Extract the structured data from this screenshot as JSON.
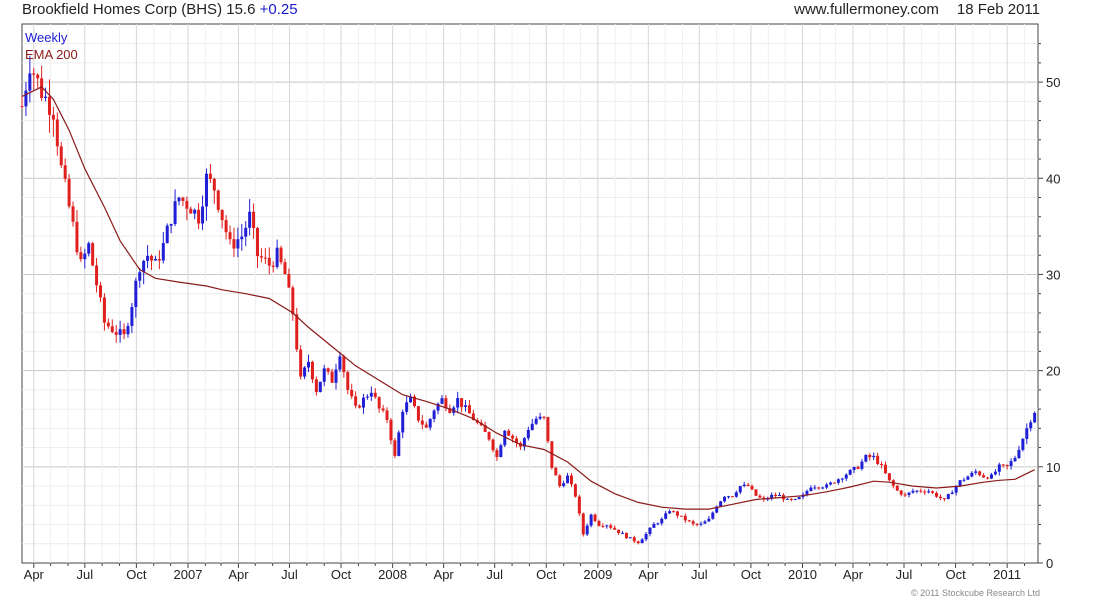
{
  "header": {
    "title": "Brookfield Homes Corp (BHS)",
    "price": "15.6",
    "change": "+0.25",
    "website": "www.fullermoney.com",
    "date": "18 Feb 2011"
  },
  "copyright": "© 2011 Stockcube Research Ltd",
  "colors": {
    "up": "#1f1fd6",
    "down": "#e0201e",
    "ema": "#8b1a1a",
    "grid": "#dedede",
    "axis": "#444444"
  },
  "chart_data": {
    "type": "candlestick",
    "legend": [
      {
        "label": "Weekly",
        "color": "#1f1fd6"
      },
      {
        "label": "EMA 200",
        "color": "#8b1a1a"
      }
    ],
    "legend_position": "top-left",
    "grid": true,
    "y_axis_side": "right",
    "ylim": [
      0,
      55
    ],
    "y_ticks": [
      0,
      10,
      20,
      30,
      40,
      50
    ],
    "xlim": [
      "2006-03-11",
      "2011-02-25"
    ],
    "x_ticks": [
      {
        "label": "Apr",
        "date": "2006-04-01"
      },
      {
        "label": "Jul",
        "date": "2006-07-01"
      },
      {
        "label": "Oct",
        "date": "2006-10-01"
      },
      {
        "label": "2007",
        "date": "2007-01-01"
      },
      {
        "label": "Apr",
        "date": "2007-04-01"
      },
      {
        "label": "Jul",
        "date": "2007-07-01"
      },
      {
        "label": "Oct",
        "date": "2007-10-01"
      },
      {
        "label": "2008",
        "date": "2008-01-01"
      },
      {
        "label": "Apr",
        "date": "2008-04-01"
      },
      {
        "label": "Jul",
        "date": "2008-07-01"
      },
      {
        "label": "Oct",
        "date": "2008-10-01"
      },
      {
        "label": "2009",
        "date": "2009-01-01"
      },
      {
        "label": "Apr",
        "date": "2009-04-01"
      },
      {
        "label": "Jul",
        "date": "2009-07-01"
      },
      {
        "label": "Oct",
        "date": "2009-10-01"
      },
      {
        "label": "2010",
        "date": "2010-01-01"
      },
      {
        "label": "Apr",
        "date": "2010-04-01"
      },
      {
        "label": "Jul",
        "date": "2010-07-01"
      },
      {
        "label": "Oct",
        "date": "2010-10-01"
      },
      {
        "label": "2011",
        "date": "2011-01-01"
      }
    ],
    "close_anchors": [
      [
        "2006-03-11",
        47.5
      ],
      [
        "2006-03-25",
        52
      ],
      [
        "2006-04-15",
        49
      ],
      [
        "2006-05-06",
        47
      ],
      [
        "2006-05-20",
        41
      ],
      [
        "2006-06-10",
        35
      ],
      [
        "2006-06-24",
        31
      ],
      [
        "2006-07-08",
        33
      ],
      [
        "2006-07-22",
        29
      ],
      [
        "2006-08-05",
        25
      ],
      [
        "2006-08-26",
        24
      ],
      [
        "2006-09-09",
        23.5
      ],
      [
        "2006-09-23",
        27
      ],
      [
        "2006-10-07",
        31
      ],
      [
        "2006-10-21",
        32
      ],
      [
        "2006-11-04",
        31
      ],
      [
        "2006-11-18",
        33
      ],
      [
        "2006-12-02",
        36
      ],
      [
        "2006-12-16",
        38
      ],
      [
        "2007-01-06",
        37
      ],
      [
        "2007-01-20",
        36
      ],
      [
        "2007-02-03",
        40
      ],
      [
        "2007-02-17",
        39
      ],
      [
        "2007-03-03",
        36
      ],
      [
        "2007-03-17",
        33
      ],
      [
        "2007-04-07",
        34
      ],
      [
        "2007-04-21",
        36
      ],
      [
        "2007-05-05",
        32
      ],
      [
        "2007-05-26",
        31
      ],
      [
        "2007-06-09",
        32
      ],
      [
        "2007-06-23",
        30
      ],
      [
        "2007-07-07",
        26
      ],
      [
        "2007-07-21",
        19
      ],
      [
        "2007-08-04",
        21
      ],
      [
        "2007-08-18",
        18
      ],
      [
        "2007-09-01",
        20
      ],
      [
        "2007-09-15",
        19
      ],
      [
        "2007-09-29",
        22
      ],
      [
        "2007-10-13",
        18
      ],
      [
        "2007-10-27",
        16
      ],
      [
        "2007-11-10",
        17
      ],
      [
        "2007-11-24",
        18
      ],
      [
        "2007-12-08",
        16
      ],
      [
        "2007-12-22",
        15
      ],
      [
        "2008-01-05",
        11
      ],
      [
        "2008-01-19",
        16
      ],
      [
        "2008-02-02",
        17
      ],
      [
        "2008-02-16",
        15
      ],
      [
        "2008-03-01",
        14
      ],
      [
        "2008-03-15",
        16
      ],
      [
        "2008-03-29",
        17
      ],
      [
        "2008-04-12",
        16
      ],
      [
        "2008-04-26",
        17
      ],
      [
        "2008-05-10",
        16
      ],
      [
        "2008-05-24",
        15
      ],
      [
        "2008-06-07",
        14
      ],
      [
        "2008-06-21",
        13
      ],
      [
        "2008-07-05",
        11
      ],
      [
        "2008-07-19",
        14
      ],
      [
        "2008-08-02",
        13
      ],
      [
        "2008-08-16",
        12
      ],
      [
        "2008-08-30",
        14
      ],
      [
        "2008-09-13",
        15
      ],
      [
        "2008-09-27",
        15
      ],
      [
        "2008-10-11",
        10
      ],
      [
        "2008-10-25",
        8
      ],
      [
        "2008-11-08",
        9
      ],
      [
        "2008-11-22",
        7
      ],
      [
        "2008-12-06",
        3
      ],
      [
        "2008-12-20",
        5
      ],
      [
        "2009-01-03",
        4
      ],
      [
        "2009-01-17",
        4
      ],
      [
        "2009-01-31",
        3.5
      ],
      [
        "2009-02-14",
        3
      ],
      [
        "2009-02-28",
        2.5
      ],
      [
        "2009-03-14",
        2.2
      ],
      [
        "2009-03-28",
        3
      ],
      [
        "2009-04-11",
        4
      ],
      [
        "2009-04-25",
        4.5
      ],
      [
        "2009-05-09",
        5.5
      ],
      [
        "2009-05-23",
        5
      ],
      [
        "2009-06-06",
        4.5
      ],
      [
        "2009-06-20",
        4
      ],
      [
        "2009-07-04",
        4
      ],
      [
        "2009-07-18",
        4.5
      ],
      [
        "2009-08-01",
        6
      ],
      [
        "2009-08-15",
        7
      ],
      [
        "2009-08-29",
        7
      ],
      [
        "2009-09-12",
        8
      ],
      [
        "2009-09-26",
        8
      ],
      [
        "2009-10-10",
        7
      ],
      [
        "2009-10-24",
        6.5
      ],
      [
        "2009-11-07",
        7
      ],
      [
        "2009-11-21",
        7
      ],
      [
        "2009-12-05",
        6.5
      ],
      [
        "2009-12-19",
        6.5
      ],
      [
        "2010-01-02",
        7
      ],
      [
        "2010-01-16",
        8
      ],
      [
        "2010-01-30",
        8
      ],
      [
        "2010-02-13",
        8
      ],
      [
        "2010-02-27",
        8.5
      ],
      [
        "2010-03-13",
        9
      ],
      [
        "2010-03-27",
        9.5
      ],
      [
        "2010-04-10",
        10
      ],
      [
        "2010-04-24",
        11
      ],
      [
        "2010-05-08",
        11
      ],
      [
        "2010-05-22",
        10
      ],
      [
        "2010-06-05",
        8.5
      ],
      [
        "2010-06-19",
        7.5
      ],
      [
        "2010-07-03",
        7
      ],
      [
        "2010-07-17",
        7.5
      ],
      [
        "2010-07-31",
        7.5
      ],
      [
        "2010-08-14",
        7.5
      ],
      [
        "2010-08-28",
        7
      ],
      [
        "2010-09-11",
        6.5
      ],
      [
        "2010-09-25",
        7.5
      ],
      [
        "2010-10-09",
        8.5
      ],
      [
        "2010-10-23",
        9
      ],
      [
        "2010-11-06",
        9.5
      ],
      [
        "2010-11-20",
        9
      ],
      [
        "2010-12-04",
        9
      ],
      [
        "2010-12-18",
        10
      ],
      [
        "2011-01-01",
        10
      ],
      [
        "2011-01-15",
        11
      ],
      [
        "2011-01-29",
        13
      ],
      [
        "2011-02-12",
        15
      ],
      [
        "2011-02-19",
        15.6
      ]
    ],
    "ema200": [
      [
        "2006-03-11",
        48.5
      ],
      [
        "2006-04-15",
        49.5
      ],
      [
        "2006-05-06",
        48.2
      ],
      [
        "2006-06-03",
        45
      ],
      [
        "2006-07-01",
        41
      ],
      [
        "2006-08-05",
        37
      ],
      [
        "2006-09-02",
        33.5
      ],
      [
        "2006-10-07",
        30.5
      ],
      [
        "2006-11-04",
        29.6
      ],
      [
        "2006-12-16",
        29.2
      ],
      [
        "2007-02-03",
        28.8
      ],
      [
        "2007-03-03",
        28.4
      ],
      [
        "2007-04-14",
        28
      ],
      [
        "2007-05-26",
        27.5
      ],
      [
        "2007-07-07",
        26
      ],
      [
        "2007-08-04",
        24.5
      ],
      [
        "2007-09-15",
        22.5
      ],
      [
        "2007-10-27",
        20.5
      ],
      [
        "2007-12-08",
        19
      ],
      [
        "2008-01-19",
        17.5
      ],
      [
        "2008-03-01",
        16.8
      ],
      [
        "2008-04-12",
        16
      ],
      [
        "2008-05-24",
        15
      ],
      [
        "2008-07-05",
        13.5
      ],
      [
        "2008-08-16",
        12.3
      ],
      [
        "2008-09-27",
        11.8
      ],
      [
        "2008-11-08",
        10.5
      ],
      [
        "2008-12-20",
        8.5
      ],
      [
        "2009-01-31",
        7.2
      ],
      [
        "2009-03-14",
        6.3
      ],
      [
        "2009-04-25",
        5.8
      ],
      [
        "2009-06-06",
        5.6
      ],
      [
        "2009-07-18",
        5.6
      ],
      [
        "2009-08-29",
        6.1
      ],
      [
        "2009-10-10",
        6.6
      ],
      [
        "2009-11-21",
        6.8
      ],
      [
        "2010-01-02",
        7
      ],
      [
        "2010-02-13",
        7.4
      ],
      [
        "2010-03-27",
        7.9
      ],
      [
        "2010-05-08",
        8.5
      ],
      [
        "2010-06-05",
        8.4
      ],
      [
        "2010-07-17",
        8
      ],
      [
        "2010-08-28",
        7.8
      ],
      [
        "2010-10-09",
        8
      ],
      [
        "2010-11-20",
        8.4
      ],
      [
        "2010-12-18",
        8.6
      ],
      [
        "2011-01-15",
        8.7
      ],
      [
        "2011-02-19",
        9.7
      ]
    ]
  }
}
